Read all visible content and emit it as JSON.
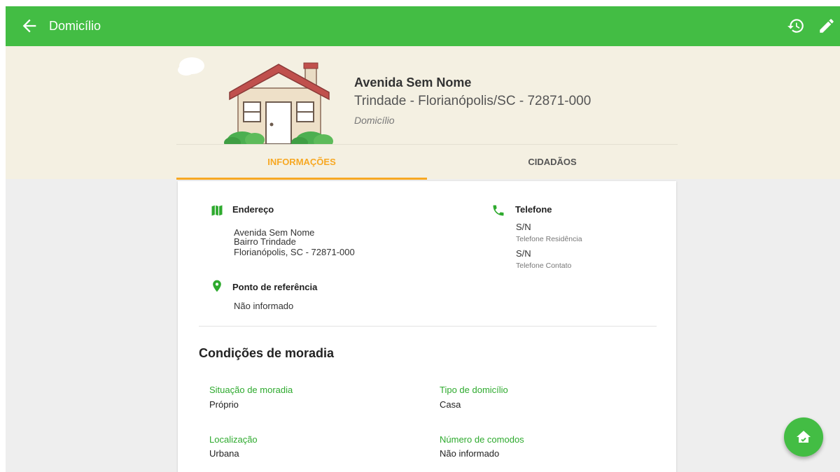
{
  "appbar": {
    "title": "Domicílio",
    "back_icon": "arrow-back-icon",
    "history_icon": "history-icon",
    "edit_icon": "edit-pencil-icon",
    "color": "#43bd44"
  },
  "header": {
    "street": "Avenida Sem Nome",
    "city_line": "Trindade - Florianópolis/SC - 72871-000",
    "type": "Domicílio",
    "illustration": "house-illustration"
  },
  "tabs": [
    {
      "label": "INFORMAÇÕES",
      "active": true
    },
    {
      "label": "CIDADÃOS",
      "active": false
    }
  ],
  "address": {
    "title": "Endereço",
    "icon": "map-icon",
    "lines": [
      "Avenida Sem Nome",
      "Bairro Trindade",
      "Florianópolis, SC - 72871-000"
    ]
  },
  "reference": {
    "title": "Ponto de referência",
    "icon": "location-pin-icon",
    "value": "Não informado"
  },
  "phone": {
    "title": "Telefone",
    "icon": "phone-icon",
    "items": [
      {
        "value": "S/N",
        "label": "Telefone Residência"
      },
      {
        "value": "S/N",
        "label": "Telefone Contato"
      }
    ]
  },
  "conditions": {
    "title": "Condições de moradia",
    "fields": [
      {
        "label": "Situação de moradia",
        "value": "Próprio"
      },
      {
        "label": "Tipo de domicílio",
        "value": "Casa"
      },
      {
        "label": "Localização",
        "value": "Urbana"
      },
      {
        "label": "Número de comodos",
        "value": "Não informado"
      }
    ]
  },
  "fab": {
    "icon": "home-visit-icon"
  },
  "colors": {
    "accent": "#f7a823",
    "label_green": "#2eaa2e",
    "hero_bg": "#f4f0e2"
  }
}
